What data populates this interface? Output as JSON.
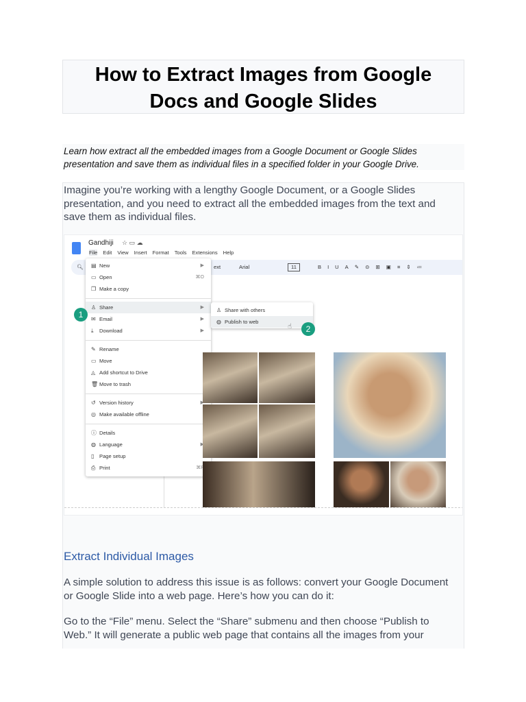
{
  "title": "How to Extract Images from Google Docs and Google Slides",
  "title_lines": [
    "How to Extract Images from Google",
    "Docs and Google Slides"
  ],
  "subtitle_lines": [
    "Learn how extract all the embedded images from a Google Document or Google Slides",
    "presentation and save them as individual files in a specified folder in your Google Drive."
  ],
  "intro_lines": [
    "Imagine you’re working with a lengthy Google Document, or a Google Slides",
    "presentation, and you need to extract all the embedded images from the text and",
    "save them as individual files."
  ],
  "screenshot": {
    "doc_title": "Gandhiji",
    "menubar": [
      "File",
      "Edit",
      "View",
      "Insert",
      "Format",
      "Tools",
      "Extensions",
      "Help"
    ],
    "toolbar": {
      "style": "ext",
      "font": "Arial",
      "size": "11"
    },
    "file_menu": [
      {
        "label": "New",
        "icon": "doc-icon",
        "arrow": true
      },
      {
        "label": "Open",
        "icon": "folder-icon",
        "shortcut": "⌘O"
      },
      {
        "label": "Make a copy",
        "icon": "copy-icon"
      },
      {
        "label": "Share",
        "icon": "person-add-icon",
        "arrow": true
      },
      {
        "label": "Email",
        "icon": "mail-icon",
        "arrow": true
      },
      {
        "label": "Download",
        "icon": "download-icon",
        "arrow": true
      },
      {
        "label": "Rename",
        "icon": "rename-icon"
      },
      {
        "label": "Move",
        "icon": "move-icon"
      },
      {
        "label": "Add shortcut to Drive",
        "icon": "drive-shortcut-icon"
      },
      {
        "label": "Move to trash",
        "icon": "trash-icon"
      },
      {
        "label": "Version history",
        "icon": "history-icon",
        "arrow": true
      },
      {
        "label": "Make available offline",
        "icon": "offline-icon"
      },
      {
        "label": "Details",
        "icon": "info-icon"
      },
      {
        "label": "Language",
        "icon": "globe-icon",
        "arrow": true
      },
      {
        "label": "Page setup",
        "icon": "page-icon"
      },
      {
        "label": "Print",
        "icon": "print-icon",
        "shortcut": "⌘P"
      }
    ],
    "share_submenu": [
      "Share with others",
      "Publish to web"
    ],
    "badges": [
      "1",
      "2"
    ],
    "accent": "#1a9e80"
  },
  "heading": "Extract Individual Images",
  "para1_lines": [
    "A simple solution to address this issue is as follows: convert your Google Document",
    "or Google Slide into a web page. Here’s how you can do it:"
  ],
  "para2_lines": [
    "Go to the “File” menu. Select the “Share” submenu and then choose “Publish to",
    "Web.” It will generate a public web page that contains all the images from your"
  ]
}
